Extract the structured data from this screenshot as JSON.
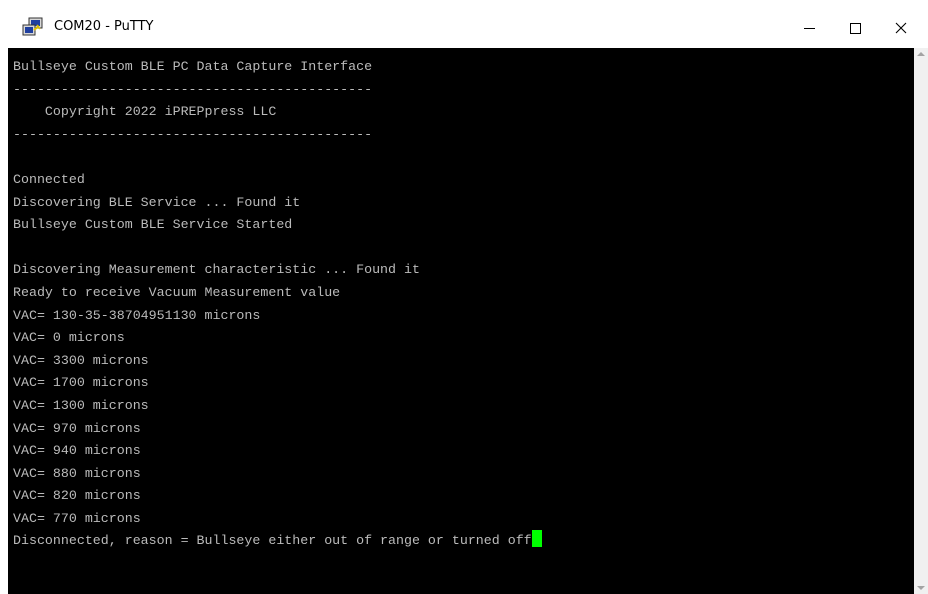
{
  "window": {
    "title": "COM20 - PuTTY",
    "icon": "putty-icon",
    "controls": {
      "minimize": "minimize-icon",
      "maximize": "maximize-icon",
      "close": "close-icon"
    }
  },
  "terminal": {
    "foreground": "#bbbbbb",
    "background": "#000000",
    "cursor_color": "#00ff00",
    "lines": [
      "Bullseye Custom BLE PC Data Capture Interface",
      "---------------------------------------------",
      "    Copyright 2022 iPREPpress LLC",
      "---------------------------------------------",
      "",
      "Connected",
      "Discovering BLE Service ... Found it",
      "Bullseye Custom BLE Service Started",
      "",
      "Discovering Measurement characteristic ... Found it",
      "Ready to receive Vacuum Measurement value",
      "VAC= 130-35-38704951130 microns",
      "VAC= 0 microns",
      "VAC= 3300 microns",
      "VAC= 1700 microns",
      "VAC= 1300 microns",
      "VAC= 970 microns",
      "VAC= 940 microns",
      "VAC= 880 microns",
      "VAC= 820 microns",
      "VAC= 770 microns",
      "Disconnected, reason = Bullseye either out of range or turned off"
    ]
  }
}
